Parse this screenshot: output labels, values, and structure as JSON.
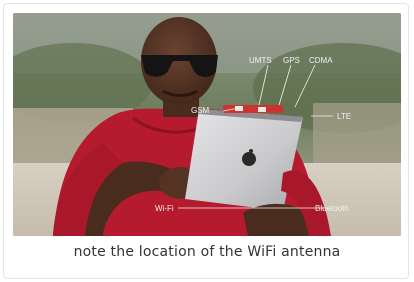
{
  "caption": "note the location of the WiFi antenna",
  "photo": {
    "labels": {
      "umts": "UMTS",
      "gps": "GPS",
      "cdma": "CDMA",
      "gsm": "GSM",
      "lte": "LTE",
      "wifi": "Wi-Fi",
      "bluetooth": "Bluetooth"
    }
  }
}
